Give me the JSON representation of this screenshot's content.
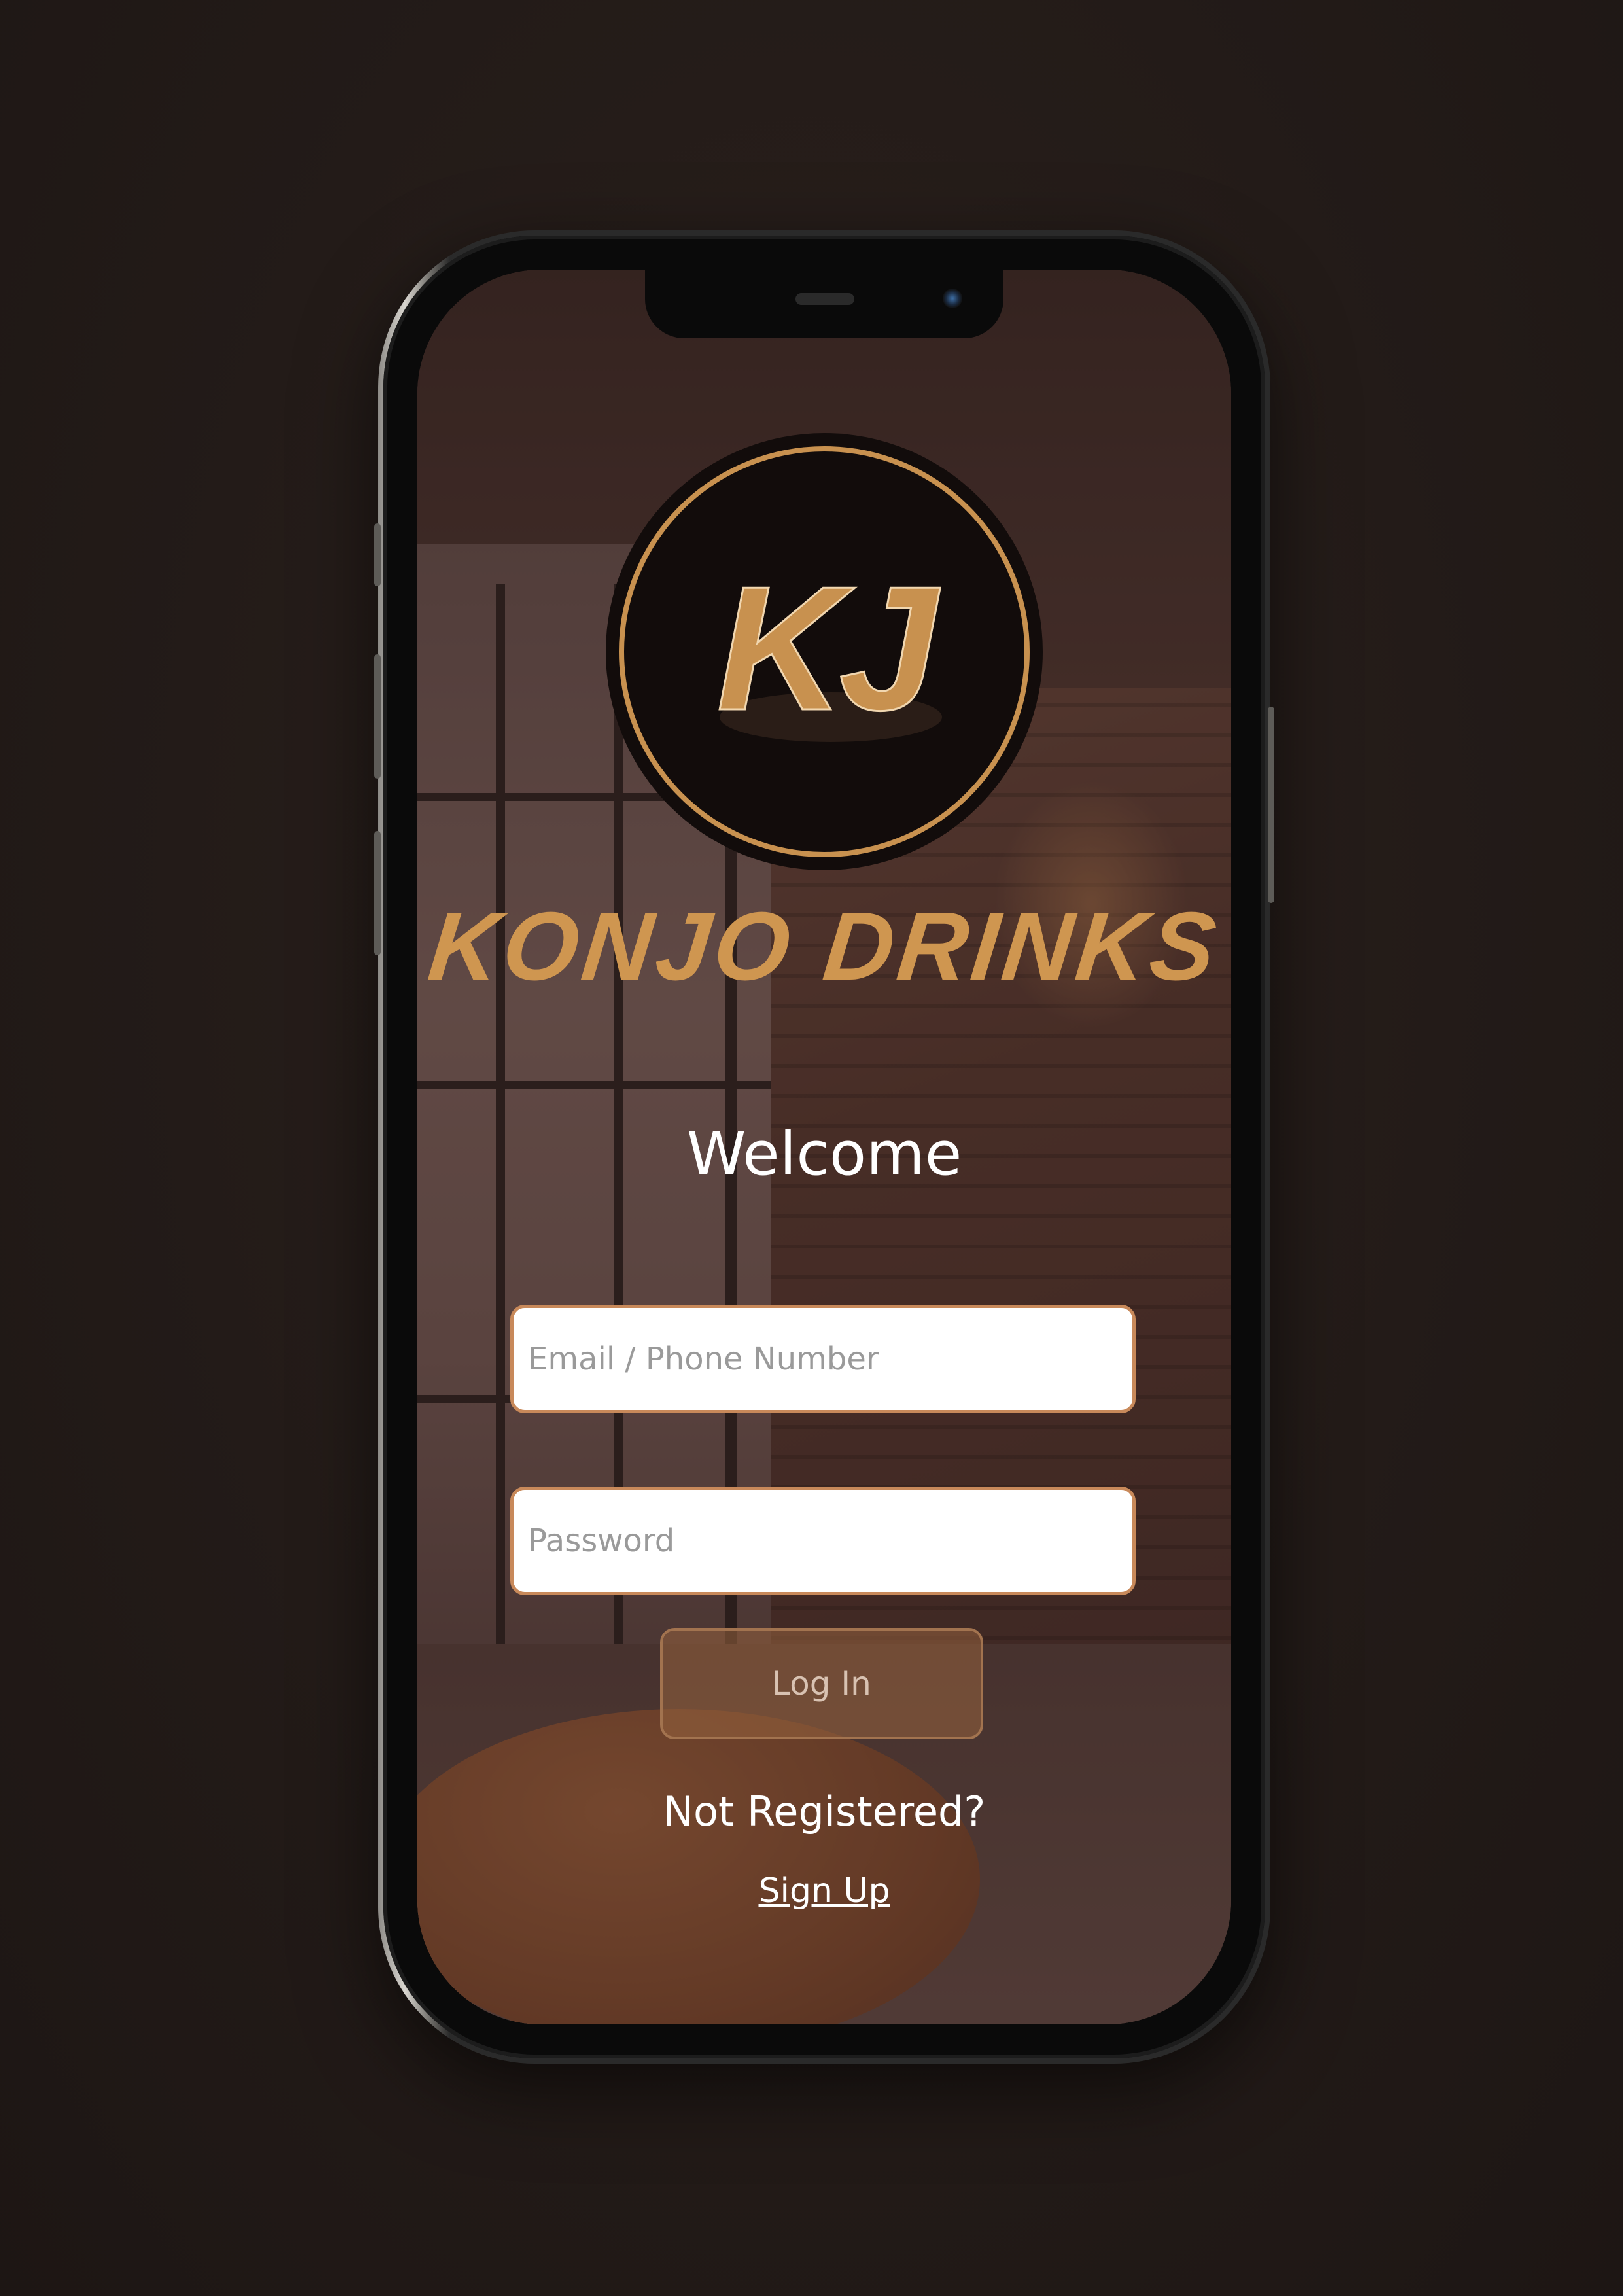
{
  "app": {
    "brand_name": "KONJO DRINKS",
    "logo_text": "KJ",
    "accent_color": "#cf9650"
  },
  "screen": {
    "welcome_title": "Welcome"
  },
  "form": {
    "email_placeholder": "Email / Phone Number",
    "password_placeholder": "Password",
    "login_label": "Log In"
  },
  "footer": {
    "not_registered_text": "Not Registered?",
    "signup_link": "Sign Up"
  }
}
